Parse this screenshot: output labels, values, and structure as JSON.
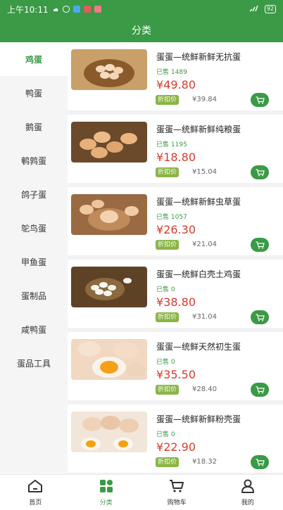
{
  "status_bar": {
    "time": "上午10:11",
    "battery": "92"
  },
  "header": {
    "title": "分类"
  },
  "sidebar": {
    "items": [
      {
        "label": "鸡蛋",
        "active": true
      },
      {
        "label": "鸭蛋",
        "active": false
      },
      {
        "label": "鹅蛋",
        "active": false
      },
      {
        "label": "鹌鹑蛋",
        "active": false
      },
      {
        "label": "鸽子蛋",
        "active": false
      },
      {
        "label": "鸵鸟蛋",
        "active": false
      },
      {
        "label": "甲鱼蛋",
        "active": false
      },
      {
        "label": "蛋制品",
        "active": false
      },
      {
        "label": "咸鸭蛋",
        "active": false
      },
      {
        "label": "蛋品工具",
        "active": false
      }
    ]
  },
  "products": [
    {
      "title": "蛋蛋—统鲜新鲜无抗蛋",
      "sold_label": "已售",
      "sold": "1489",
      "currency": "¥",
      "price": "49.80",
      "discount_label": "折扣价",
      "orig_currency": "¥",
      "orig_price": "39.84"
    },
    {
      "title": "蛋蛋—统鲜新鲜纯粮蛋",
      "sold_label": "已售",
      "sold": "1195",
      "currency": "¥",
      "price": "18.80",
      "discount_label": "折扣价",
      "orig_currency": "¥",
      "orig_price": "15.04"
    },
    {
      "title": "蛋蛋—统鲜新鲜虫草蛋",
      "sold_label": "已售",
      "sold": "1057",
      "currency": "¥",
      "price": "26.30",
      "discount_label": "折扣价",
      "orig_currency": "¥",
      "orig_price": "21.04"
    },
    {
      "title": "蛋蛋—统鲜白壳土鸡蛋",
      "sold_label": "已售",
      "sold": "0",
      "currency": "¥",
      "price": "38.80",
      "discount_label": "折扣价",
      "orig_currency": "¥",
      "orig_price": "31.04"
    },
    {
      "title": "蛋蛋—统鲜天然初生蛋",
      "sold_label": "已售",
      "sold": "0",
      "currency": "¥",
      "price": "35.50",
      "discount_label": "折扣价",
      "orig_currency": "¥",
      "orig_price": "28.40"
    },
    {
      "title": "蛋蛋—统鲜新鲜粉壳蛋",
      "sold_label": "已售",
      "sold": "0",
      "currency": "¥",
      "price": "22.90",
      "discount_label": "折扣价",
      "orig_currency": "¥",
      "orig_price": "18.32"
    }
  ],
  "tabbar": {
    "items": [
      {
        "label": "首页",
        "icon": "home-icon",
        "active": false
      },
      {
        "label": "分类",
        "icon": "category-icon",
        "active": true
      },
      {
        "label": "购物车",
        "icon": "cart-icon",
        "active": false
      },
      {
        "label": "我的",
        "icon": "user-icon",
        "active": false
      }
    ]
  },
  "colors": {
    "brand": "#3a9a46",
    "price": "#d63c2c",
    "discount_badge": "#8ab546"
  }
}
